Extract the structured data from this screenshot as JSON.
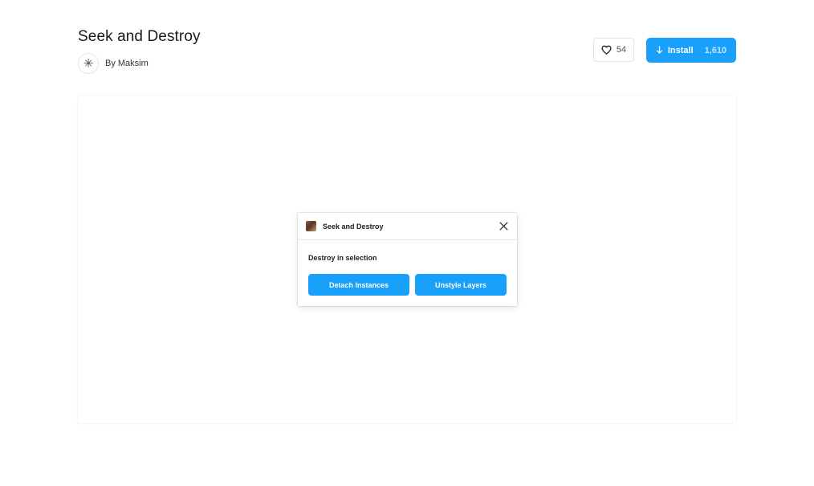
{
  "header": {
    "title": "Seek and Destroy",
    "author_label": "By Maksim",
    "avatar_icon": "asterisk-icon"
  },
  "actions": {
    "like_count": "54",
    "like_icon": "heart-icon",
    "install_label": "Install",
    "install_count": "1,610",
    "install_icon": "arrow-down-icon"
  },
  "plugin_window": {
    "title": "Seek and Destroy",
    "section_label": "Destroy in selection",
    "buttons": [
      {
        "label": "Detach Instances"
      },
      {
        "label": "Unstyle Layers"
      }
    ]
  },
  "colors": {
    "accent": "#18a0fb",
    "install_count_text": "#bfe3ff"
  }
}
